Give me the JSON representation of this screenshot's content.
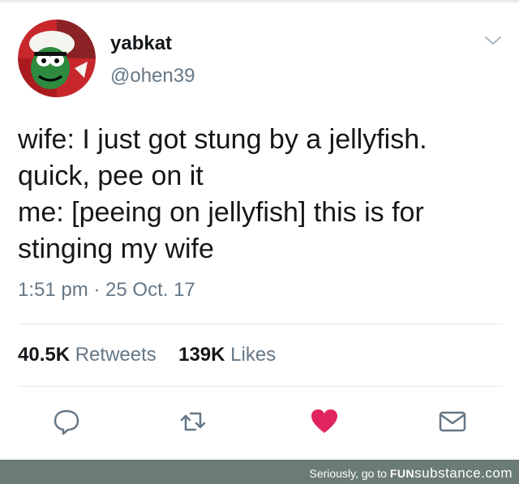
{
  "tweet": {
    "display_name": "yabkat",
    "handle": "@ohen39",
    "text_lines": [
      "wife: I just got stung by a jellyfish.",
      "quick, pee on it",
      "me: [peeing on jellyfish] this is for",
      "stinging my wife"
    ],
    "timestamp": "1:51 pm · 25 Oct. 17",
    "retweets_count": "40.5K",
    "retweets_label": "Retweets",
    "likes_count": "139K",
    "likes_label": "Likes"
  },
  "actions": {
    "reply_icon": "speech-bubble-icon",
    "retweet_icon": "retweet-arrows-icon",
    "like_icon": "heart-icon",
    "dm_icon": "envelope-icon"
  },
  "footer": {
    "prefix": "Seriously, go to ",
    "brand_fun": "FUN",
    "brand_sub": "substance",
    "brand_suffix": ".com"
  },
  "colors": {
    "text": "#14171a",
    "secondary": "#657786",
    "like": "#e0245e",
    "footer_bg": "#6b7b76"
  }
}
